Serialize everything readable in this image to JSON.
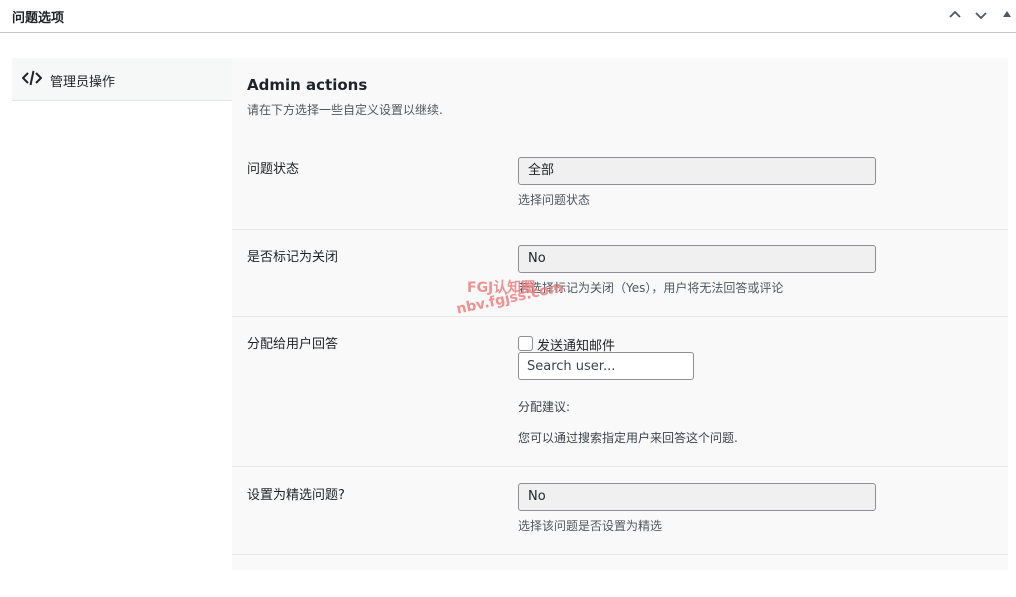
{
  "header": {
    "title": "问题选项",
    "buttons": [
      "chevron-up-icon",
      "chevron-down-icon",
      "triangle-up-icon"
    ]
  },
  "nav": {
    "tab_label": "管理员操作",
    "tab_icon": "code-icon"
  },
  "section": {
    "title": "Admin actions",
    "description": "请在下方选择一些自定义设置以继续."
  },
  "fields": {
    "status": {
      "label": "问题状态",
      "value": "全部",
      "hint": "选择问题状态"
    },
    "closed": {
      "label": "是否标记为关闭",
      "value": "No",
      "hint": "若选择标记为关闭（Yes），用户将无法回答或评论"
    },
    "assign": {
      "label": "分配给用户回答",
      "checkbox_label": "发送通知邮件",
      "search_placeholder": "Search user...",
      "suggest_label": "分配建议:",
      "suggest_text": "您可以通过搜索指定用户来回答这个问题."
    },
    "featured": {
      "label": "设置为精选问题?",
      "value": "No",
      "hint": "选择该问题是否设置为精选"
    }
  },
  "watermark": {
    "line1": "FGJ认知圈",
    "line2": "nbv.fgjss.com"
  },
  "colors": {
    "watermark": "#f08080",
    "panel_bg": "#f9f9f9",
    "select_bg": "#f0f0f1"
  }
}
